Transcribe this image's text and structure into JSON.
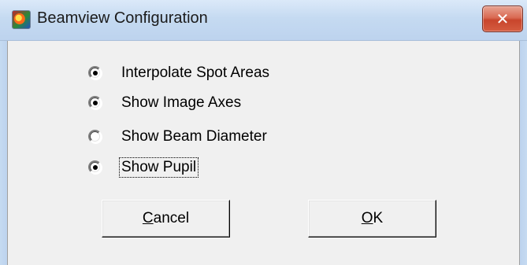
{
  "window": {
    "title": "Beamview Configuration",
    "close_glyph": "✕",
    "app_icon": "beamview-app-icon"
  },
  "options": [
    {
      "label": "Interpolate Spot Areas",
      "checked": true
    },
    {
      "label": "Show Image Axes",
      "checked": true
    },
    {
      "label": "Show Beam Diameter",
      "checked": false
    },
    {
      "label": "Show Pupil",
      "checked": true,
      "focused": true
    }
  ],
  "buttons": {
    "cancel_label": "Cancel",
    "ok_label": "OK"
  },
  "colors": {
    "dialog_background": "#f0f0f0",
    "titlebar": "#c5daf1",
    "close_button": "#c8452c"
  }
}
